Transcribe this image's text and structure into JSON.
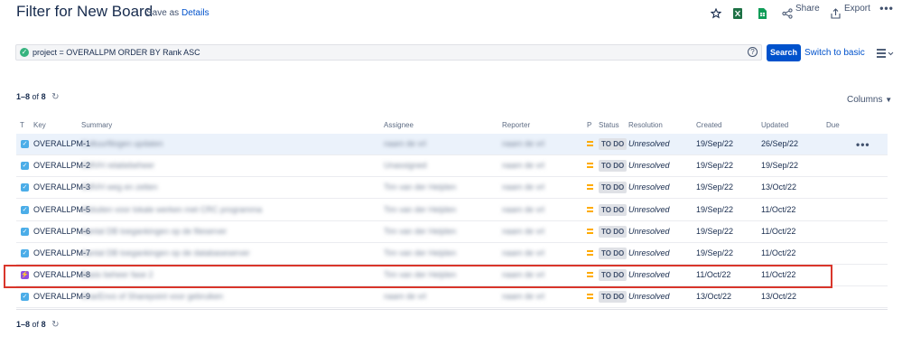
{
  "header": {
    "title": "Filter for New Board",
    "save_as": "Save as",
    "details": "Details",
    "share": "Share",
    "export": "Export"
  },
  "search": {
    "jql": "project = OVERALLPM ORDER BY Rank ASC",
    "button": "Search",
    "switch_label": "Switch to basic"
  },
  "results": {
    "range": "1–8",
    "of": "of",
    "total": "8",
    "columns_label": "Columns"
  },
  "table": {
    "headers": {
      "t": "T",
      "key": "Key",
      "summary": "Summary",
      "assignee": "Assignee",
      "reporter": "Reporter",
      "p": "P",
      "status": "Status",
      "resolution": "Resolution",
      "created": "Created",
      "updated": "Updated",
      "due": "Due"
    },
    "rows": [
      {
        "type": "task",
        "key": "OVERALLPM-1",
        "summary": "Cultuurfilogen updaten",
        "assignee": "naam de vrl",
        "reporter": "naam de vrl",
        "status": "TO DO",
        "resolution": "Unresolved",
        "created": "19/Sep/22",
        "updated": "26/Sep/22"
      },
      {
        "type": "task",
        "key": "OVERALLPM-2",
        "summary": "SMVH relatiebeheer",
        "assignee": "Unassigned",
        "reporter": "naam de vrl",
        "status": "TO DO",
        "resolution": "Unresolved",
        "created": "19/Sep/22",
        "updated": "19/Sep/22"
      },
      {
        "type": "task",
        "key": "OVERALLPM-3",
        "summary": "SMVH weg en zetten",
        "assignee": "Tim van der Heijden",
        "reporter": "naam de vrl",
        "status": "TO DO",
        "resolution": "Unresolved",
        "created": "19/Sep/22",
        "updated": "13/Oct/22"
      },
      {
        "type": "task",
        "key": "OVERALLPM-5",
        "summary": "Afsluiten voor lokale werken met CRC programma",
        "assignee": "Tim van der Heijden",
        "reporter": "naam de vrl",
        "status": "TO DO",
        "resolution": "Unresolved",
        "created": "19/Sep/22",
        "updated": "11/Oct/22"
      },
      {
        "type": "task",
        "key": "OVERALLPM-6",
        "summary": "Aantal DB toegankingen op de fileserver",
        "assignee": "Tim van der Heijden",
        "reporter": "naam de vrl",
        "status": "TO DO",
        "resolution": "Unresolved",
        "created": "19/Sep/22",
        "updated": "11/Oct/22"
      },
      {
        "type": "task",
        "key": "OVERALLPM-7",
        "summary": "Aantal DB toegankingen op de databaseserver",
        "assignee": "Tim van der Heijden",
        "reporter": "naam de vrl",
        "status": "TO DO",
        "resolution": "Unresolved",
        "created": "19/Sep/22",
        "updated": "11/Oct/22"
      },
      {
        "type": "epic",
        "key": "OVERALLPM-8",
        "summary": "Basis beheer fase 2",
        "assignee": "Tim van der Heijden",
        "reporter": "naam de vrl",
        "status": "TO DO",
        "resolution": "Unresolved",
        "created": "11/Oct/22",
        "updated": "11/Oct/22"
      },
      {
        "type": "task",
        "key": "OVERALLPM-9",
        "summary": "SharEnvs of Sharepoint voor gebruiken",
        "assignee": "naam de vrl",
        "reporter": "naam de vrl",
        "status": "TO DO",
        "resolution": "Unresolved",
        "created": "13/Oct/22",
        "updated": "13/Oct/22"
      }
    ]
  },
  "colors": {
    "accent": "#0052cc",
    "task_icon": "#4bade8",
    "epic_icon": "#904ee2",
    "priority": "#ffab00",
    "highlight_box": "#d9362b"
  }
}
